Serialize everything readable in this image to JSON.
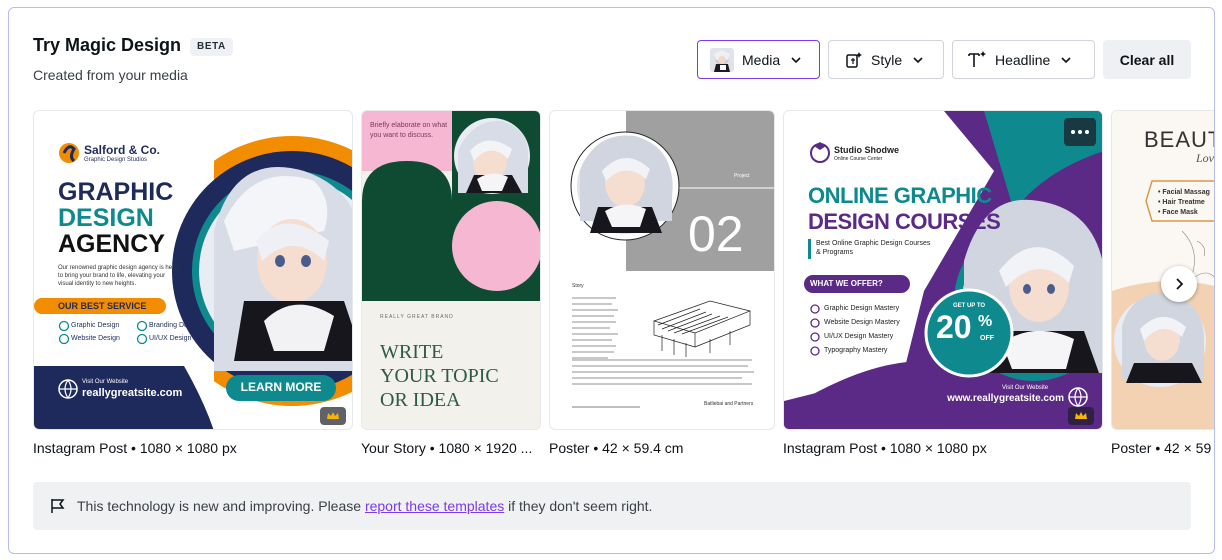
{
  "header": {
    "title": "Try Magic Design",
    "badge": "BETA",
    "subtitle": "Created from your media"
  },
  "toolbar": {
    "media_label": "Media",
    "style_label": "Style",
    "headline_label": "Headline",
    "clear_label": "Clear all"
  },
  "colors": {
    "accent": "#7c3aed",
    "navy": "#1f2a5c",
    "teal": "#0e8a8f",
    "orange": "#f28c00",
    "purple": "#5b2a86",
    "green_dark": "#0f4a32",
    "pink": "#f6b7d3"
  },
  "templates": [
    {
      "caption": "Instagram Post • 1080 × 1080 px",
      "brand": "Salford & Co.",
      "brand_sub": "Graphic Design Studios",
      "headline_1": "GRAPHIC",
      "headline_2": "DESIGN",
      "headline_3": "AGENCY",
      "body": "Our renowned graphic design agency is here to bring your brand to life, elevating your visual identity to new heights.",
      "section": "OUR BEST SERVICE",
      "services": [
        "Graphic Design",
        "Branding Design",
        "Website Design",
        "UI/UX Design"
      ],
      "visit": "Visit Our Website",
      "site": "reallygreatsite.com",
      "cta": "LEARN MORE"
    },
    {
      "caption": "Your Story • 1080 × 1920 ...",
      "top_text": "Briefly elaborate on what you want to discuss.",
      "brand": "REALLY GREAT BRAND",
      "headline_1": "WRITE",
      "headline_2": "YOUR TOPIC",
      "headline_3": "OR IDEA"
    },
    {
      "caption": "Poster • 42 × 59.4 cm",
      "tag": "Project",
      "number": "02",
      "section": "Story",
      "footer": "Batliebai and Partners"
    },
    {
      "caption": "Instagram Post • 1080 × 1080 px",
      "brand": "Studio Shodwe",
      "brand_sub": "Online Course Center",
      "headline_1": "ONLINE GRAPHIC",
      "headline_2": "DESIGN COURSES",
      "sub": "Best Online Graphic Design Courses & Programs",
      "offer": "WHAT WE OFFER?",
      "items": [
        "Graphic Design Mastery",
        "Website Design Mastery",
        "UI/UX Design Mastery",
        "Typography Mastery"
      ],
      "discount_top": "GET UP TO",
      "discount_num": "20",
      "discount_pct": "%",
      "discount_off": "OFF",
      "visit": "Visit Our Website",
      "site": "www.reallygreatsite.com"
    },
    {
      "caption": "Poster • 42 × 59",
      "headline": "BEAUT",
      "script": "Love Y",
      "items": [
        "• Facial Massag",
        "• Hair Treatme",
        "• Face Mask"
      ]
    }
  ],
  "notice": {
    "before": "This technology is new and improving. Please ",
    "link": "report these templates",
    "after": " if they don't seem right."
  },
  "icons": {
    "media_thumb": "anime-thumbnail",
    "style": "magic-style-icon",
    "headline": "text-plus-icon",
    "next": "chevron-right-icon",
    "flag": "flag-icon",
    "crown": "crown-icon",
    "more": "more-horizontal-icon"
  }
}
